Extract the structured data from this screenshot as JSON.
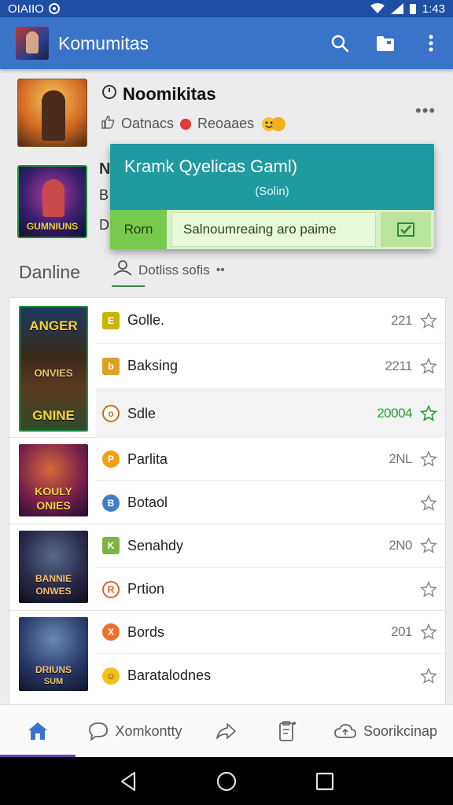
{
  "status_bar": {
    "left_text": "OIAIIO",
    "time": "1:43"
  },
  "app_bar": {
    "title": "Komumitas",
    "icons": [
      "search-icon",
      "folder-icon",
      "more-vert-icon"
    ]
  },
  "featured": {
    "title": "Noomikitas",
    "meta_left": "Oatnacs",
    "meta_right": "Reoaaes",
    "peek_initial": "N",
    "peek_b": "B",
    "peek_d": "D",
    "thumb2_caption": "GUMNIUNS"
  },
  "popup": {
    "title": "Kramk Qyelicas Gaml)",
    "subtitle": "(Solin)",
    "button_label": "Rorn",
    "field_text": "Salnoumreaing aro paime"
  },
  "section": {
    "title": "Danline",
    "tab_label": "Dotliss sofis"
  },
  "groups": [
    {
      "thumb_caption_top": "ANGER",
      "thumb_caption_mid": "ONVIES",
      "thumb_caption_bot": "GNINE",
      "rows": [
        {
          "icon_letter": "E",
          "icon_color": "#c9b400",
          "label": "Golle.",
          "value": "221",
          "highlight": false,
          "green": false
        },
        {
          "icon_letter": "b",
          "icon_color": "#e0a020",
          "label": "Baksing",
          "value": "2211",
          "highlight": false,
          "green": false
        },
        {
          "icon_letter": "o",
          "icon_color": "#c07020",
          "label": "Sdle",
          "value": "20004",
          "highlight": true,
          "green": true
        }
      ]
    },
    {
      "thumb_caption_top": "KOULY",
      "thumb_caption_bot": "ONIES",
      "rows": [
        {
          "icon_letter": "P",
          "icon_color": "#f0a010",
          "label": "Parlita",
          "value": "2NL",
          "highlight": false,
          "green": false
        },
        {
          "icon_letter": "B",
          "icon_color": "#3d7fc8",
          "label": "Botaol",
          "value": "",
          "highlight": false,
          "green": false
        }
      ]
    },
    {
      "thumb_caption_top": "BANNIE",
      "thumb_caption_bot": "ONWES",
      "rows": [
        {
          "icon_letter": "K",
          "icon_color": "#7cb342",
          "label": "Senahdy",
          "value": "2N0",
          "highlight": false,
          "green": false
        },
        {
          "icon_letter": "R",
          "icon_color": "#e06030",
          "label": "Prtion",
          "value": "",
          "highlight": false,
          "green": false
        }
      ]
    },
    {
      "thumb_caption_top": "DRIUNS",
      "thumb_caption_bot": "SUM",
      "rows": [
        {
          "icon_letter": "X",
          "icon_color": "#f07030",
          "label": "Bords",
          "value": "201",
          "highlight": false,
          "green": false
        },
        {
          "icon_letter": "☺",
          "icon_color": "#f0c020",
          "label": "Baratalodnes",
          "value": "",
          "highlight": false,
          "green": false
        }
      ]
    }
  ],
  "bottom_nav": {
    "items": [
      {
        "icon": "home-icon",
        "label": ""
      },
      {
        "icon": "chat-icon",
        "label": "Xomkontty"
      },
      {
        "icon": "share-icon",
        "label": ""
      },
      {
        "icon": "clipboard-icon",
        "label": ""
      },
      {
        "icon": "cloud-icon",
        "label": "Soorikcinap"
      }
    ],
    "active_index": 0,
    "active_color": "#3a74c9"
  },
  "colors": {
    "primary": "#3a74c9",
    "popup": "#1f9aa0",
    "accent_green": "#2e9b3a"
  }
}
